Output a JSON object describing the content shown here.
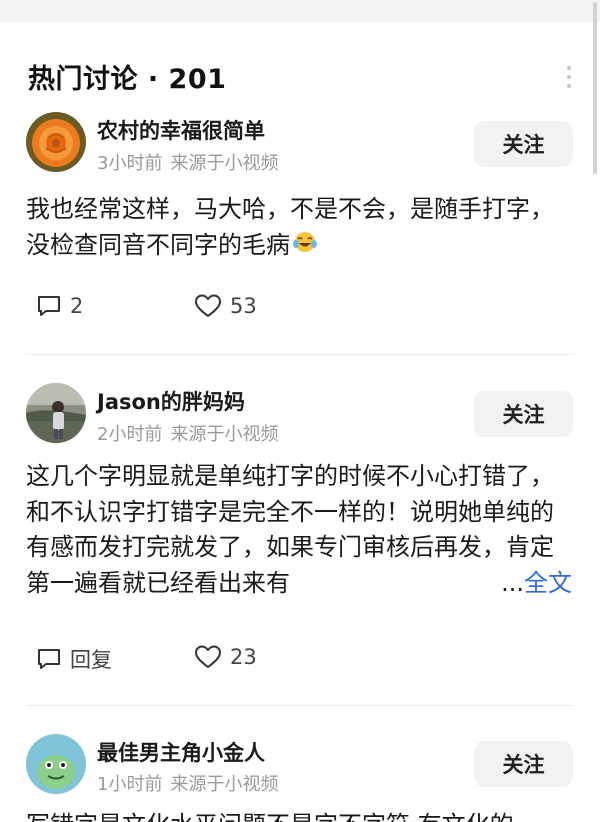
{
  "section": {
    "title": "热门讨论 · 201"
  },
  "comments": [
    {
      "username": "农村的幸福很简单",
      "time": "3小时前",
      "source": "来源于小视频",
      "follow_label": "关注",
      "text": "我也经常这样，马大哈，不是不会，是随手打字，没检查同音不同字的毛病",
      "emoji": "laughing-crying-emoji",
      "reply_label": "2",
      "likes": "53",
      "avatar": "orange-rose-avatar"
    },
    {
      "username": "Jason的胖妈妈",
      "time": "2小时前",
      "source": "来源于小视频",
      "follow_label": "关注",
      "text": "这几个字明显就是单纯打字的时候不小心打错了，和不认识字打错字是完全不一样的！说明她单纯的有感而发打完就发了，如果专门审核后再发，肯定第一遍看就已经看出来有",
      "ellipsis": "...",
      "more_label": "全文",
      "reply_label": "回复",
      "likes": "23",
      "avatar": "person-photo-avatar"
    },
    {
      "username": "最佳男主角小金人",
      "time": "1小时前",
      "source": "来源于小视频",
      "follow_label": "关注",
      "text": "写错字是文化水平问题不是字不字符 有文化的",
      "avatar": "cartoon-face-avatar"
    }
  ],
  "icons": {
    "comment": "comment-bubble-icon",
    "like": "heart-icon",
    "more": "more-vertical-icon"
  },
  "colors": {
    "link": "#2f6bd8",
    "meta": "#9a9a9a",
    "button_bg": "#f2f2f2"
  }
}
